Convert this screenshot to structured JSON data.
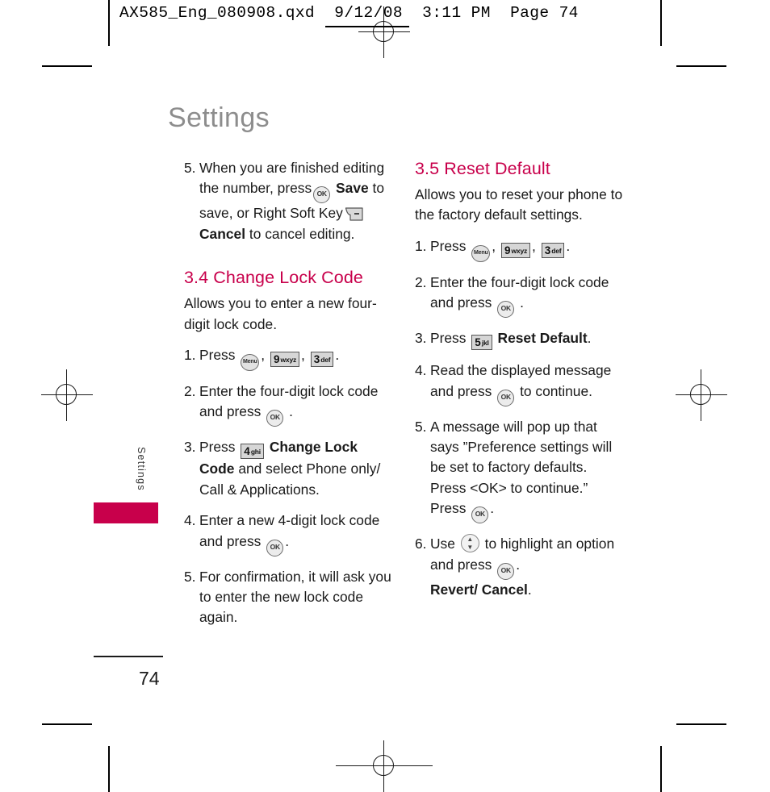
{
  "print_marks": {
    "stamp_text": "AX585_Eng_080908.qxd  9/12/08  3:11 PM  Page 74"
  },
  "page": {
    "title": "Settings",
    "side_tab_label": "Settings",
    "page_number": "74",
    "accent_color": "#c8004b",
    "title_color": "#8d8d8d"
  },
  "keys": {
    "menu": "Menu",
    "ok": "OK",
    "nine": {
      "digit": "9",
      "letters": "wxyz"
    },
    "three": {
      "digit": "3",
      "letters": "def"
    },
    "four": {
      "digit": "4",
      "letters": "ghi"
    },
    "five": {
      "digit": "5",
      "letters": "jkl"
    },
    "right_soft_key": "right-soft-key"
  },
  "left_column": {
    "continued_step": {
      "num": "5.",
      "part1": "When you are finished editing the number, press",
      "bold1": "Save",
      "part2": "to save, or Right Soft Key",
      "bold2": "Cancel",
      "part3": "to cancel editing."
    },
    "section": {
      "heading": "3.4 Change Lock Code",
      "intro": "Allows you to enter a new four-digit lock code.",
      "steps": [
        {
          "num": "1.",
          "part1": "Press",
          "sep1": ",",
          "sep2": ",",
          "part_end": "."
        },
        {
          "num": "2.",
          "part1": "Enter the four-digit lock code and press",
          "part_end": "."
        },
        {
          "num": "3.",
          "part1": "Press",
          "bold1": "Change Lock Code",
          "part2": "and select Phone only/ Call & Applications."
        },
        {
          "num": "4.",
          "part1": "Enter a new 4-digit lock code and press",
          "part_end": "."
        },
        {
          "num": "5.",
          "part1": "For confirmation, it will ask you to enter the new lock code again."
        }
      ]
    }
  },
  "right_column": {
    "section": {
      "heading": "3.5 Reset Default",
      "intro": "Allows you to reset your phone to the factory default settings.",
      "steps": [
        {
          "num": "1.",
          "part1": "Press",
          "sep1": ",",
          "sep2": ",",
          "part_end": "."
        },
        {
          "num": "2.",
          "part1": "Enter the four-digit lock code and press",
          "part_end": "."
        },
        {
          "num": "3.",
          "part1": "Press",
          "bold1": "Reset Default",
          "part_end": "."
        },
        {
          "num": "4.",
          "part1": "Read the displayed message and press",
          "part_end": "to continue."
        },
        {
          "num": "5.",
          "part1": "A message will pop up that says ”Preference settings will be set to factory defaults. Press <OK> to continue.”",
          "part2": "Press",
          "part_end": "."
        },
        {
          "num": "6.",
          "part1": "Use",
          "part2": "to highlight an option and press",
          "part_end": ".",
          "bold1": "Revert/ Cancel",
          "bold_end": "."
        }
      ]
    }
  }
}
